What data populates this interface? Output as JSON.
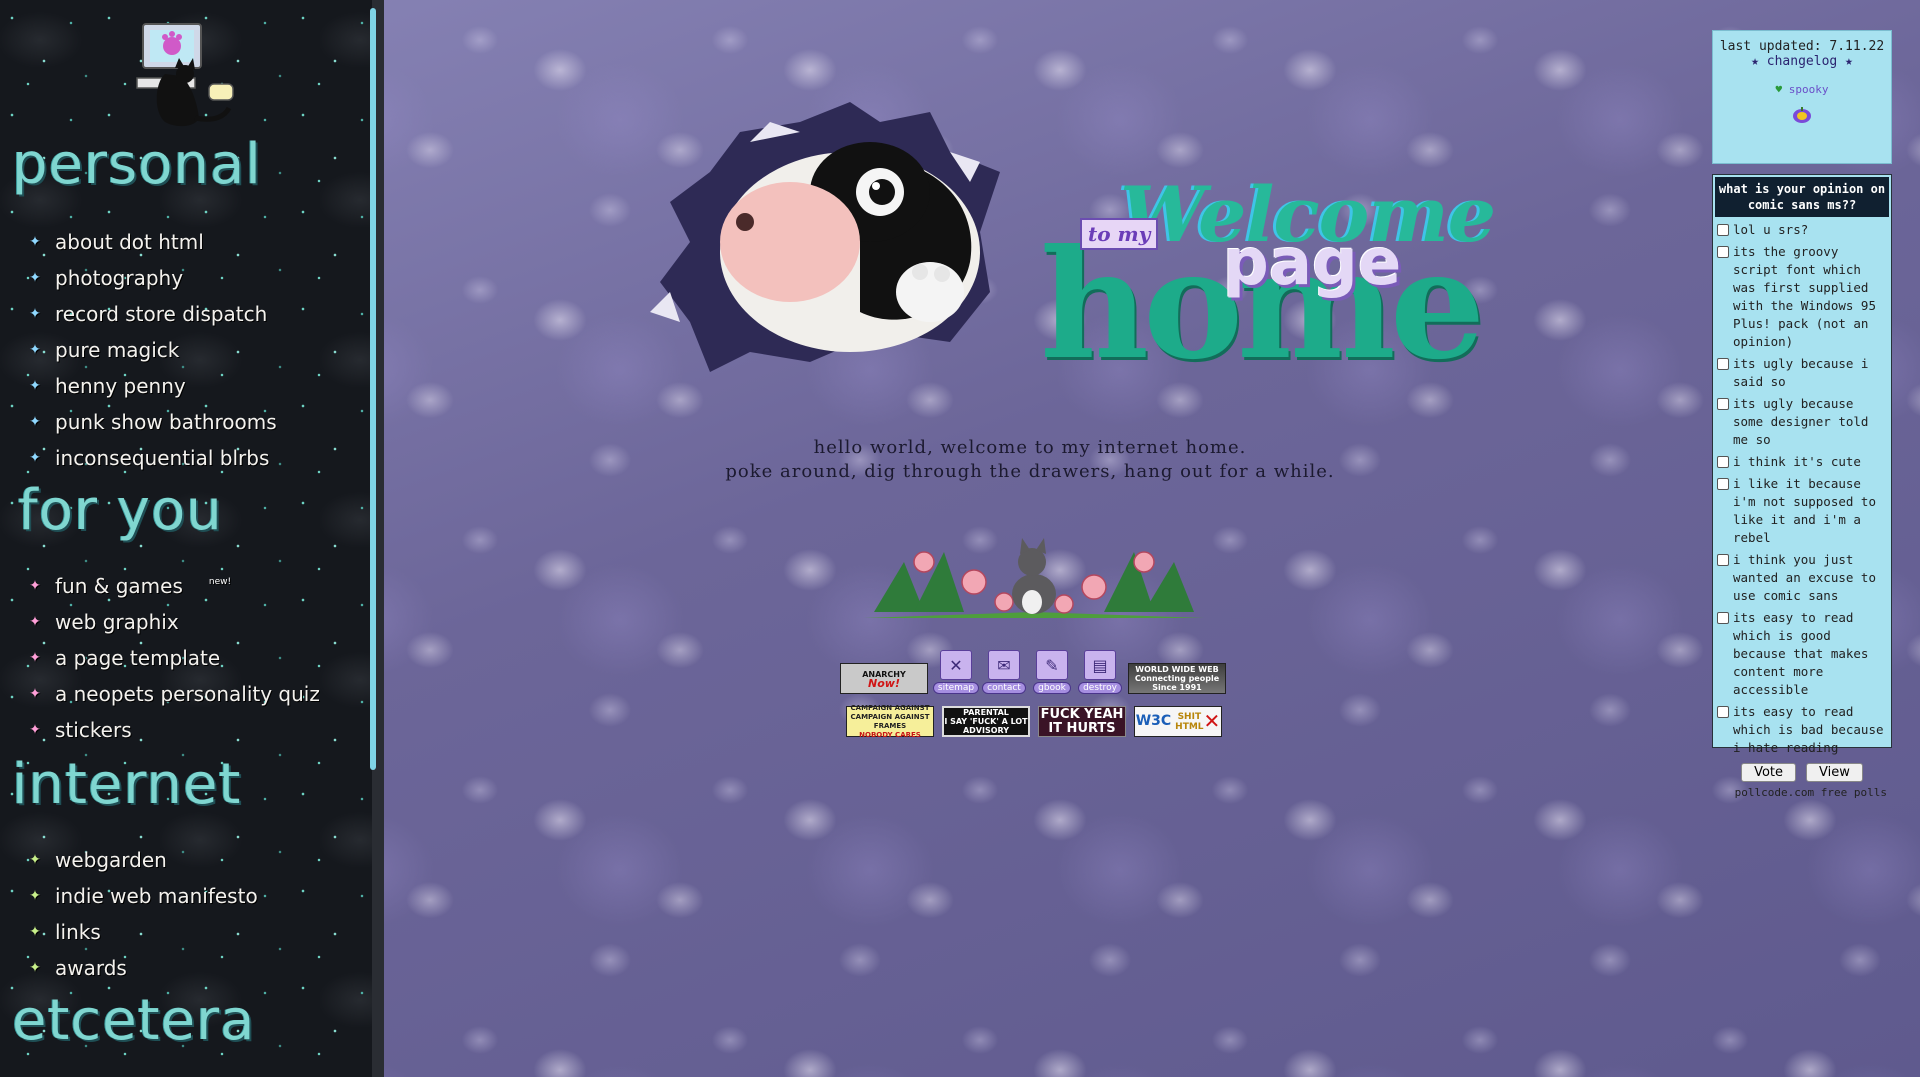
{
  "sidebar": {
    "sections": [
      {
        "title": "personal",
        "items": [
          {
            "label": "about dot html"
          },
          {
            "label": "photography"
          },
          {
            "label": "record store dispatch"
          },
          {
            "label": "pure magick"
          },
          {
            "label": "henny penny"
          },
          {
            "label": "punk show bathrooms"
          },
          {
            "label": "inconsequential blrbs"
          }
        ]
      },
      {
        "title": "for you",
        "items": [
          {
            "label": "fun & games",
            "badge": "new!"
          },
          {
            "label": "web graphix"
          },
          {
            "label": "a page template"
          },
          {
            "label": "a neopets personality quiz"
          },
          {
            "label": "stickers"
          }
        ]
      },
      {
        "title": "internet",
        "items": [
          {
            "label": "webgarden"
          },
          {
            "label": "indie web manifesto"
          },
          {
            "label": "links"
          },
          {
            "label": "awards"
          }
        ]
      },
      {
        "title": "etcetera",
        "items": []
      }
    ]
  },
  "header": {
    "to_my": "to my",
    "welcome": "Welcome",
    "page": "page",
    "home": "home"
  },
  "intro": {
    "line1": "hello world, welcome to my internet home.",
    "line2": "poke around, dig through the drawers, hang out for a while."
  },
  "buttons": {
    "anarchy_top": "ANARCHY",
    "anarchy_now": "Now!",
    "sitemap": "sitemap",
    "contact": "contact",
    "gbook": "gbook",
    "destroy": "destroy",
    "www_line1": "WORLD WIDE WEB",
    "www_line2": "Connecting people",
    "www_line3": "Since 1991",
    "frames_line1": "CAMPAIGN AGAINST",
    "frames_line2": "CAMPAIGN AGAINST",
    "frames_line3": "FRAMES",
    "frames_line4": "NOBODY CARES",
    "parental_line1": "PARENTAL",
    "parental_line2": "I SAY 'FUCK' A LOT",
    "parental_line3": "ADVISORY",
    "fuck_line1": "FUCK YEAH",
    "fuck_line2": "IT HURTS",
    "w3c_text": "W3C",
    "w3c_shit": "SHIT",
    "w3c_html": "HTML"
  },
  "updated": {
    "text": "last updated: 7.11.22",
    "changelog": "★ changelog ★",
    "spooky": "spooky"
  },
  "poll": {
    "question": "what is your opinion on comic sans ms??",
    "options": [
      "lol u srs?",
      "its the groovy script font which was first supplied with the Windows 95 Plus! pack (not an opinion)",
      "its ugly because i said so",
      "its ugly because some designer told me so",
      "i think it's cute",
      "i like it because i'm not supposed to like it and i'm a rebel",
      "i think you just wanted an excuse to use comic sans",
      "its easy to read which is good because that makes content more accessible",
      "its easy to read which is bad because i hate reading"
    ],
    "vote_label": "Vote",
    "view_label": "View",
    "footer": "pollcode.com free polls"
  },
  "colors": {
    "sidebar_bg": "#15181d",
    "section_title": "#7fd6d0",
    "panel_bg": "#a8e2f0",
    "page_bg": "#6b6599"
  }
}
